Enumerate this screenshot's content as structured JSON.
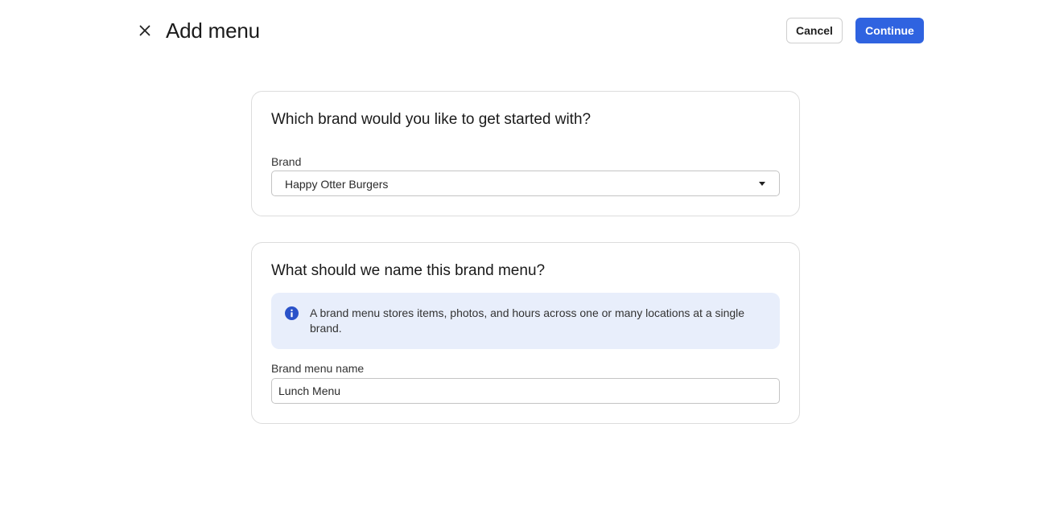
{
  "header": {
    "title": "Add menu",
    "cancel_label": "Cancel",
    "continue_label": "Continue"
  },
  "brand_section": {
    "heading": "Which brand would you like to get started with?",
    "field_label": "Brand",
    "selected_value": "Happy Otter Burgers"
  },
  "name_section": {
    "heading": "What should we name this brand menu?",
    "info_text": "A brand menu stores items, photos, and hours across one or many locations at a single brand.",
    "field_label": "Brand menu name",
    "input_value": "Lunch Menu"
  },
  "icons": {
    "close": "close-icon",
    "caret": "chevron-down-icon",
    "info": "info-icon"
  },
  "colors": {
    "primary": "#2f63e0",
    "info_bg": "#e8eefb",
    "info_icon": "#2a52c9"
  }
}
